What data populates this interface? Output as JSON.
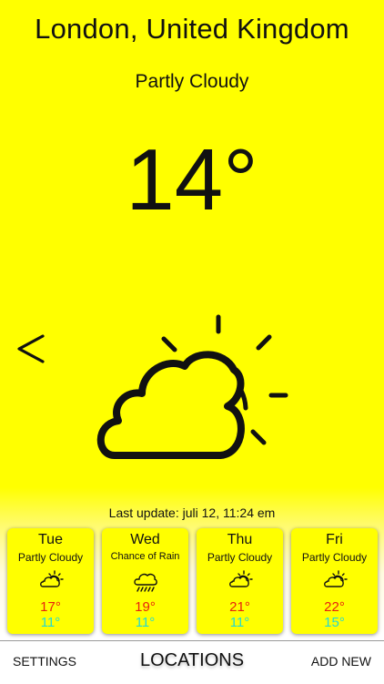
{
  "location": "London, United Kingdom",
  "current": {
    "condition": "Partly Cloudy",
    "temperature": "14°",
    "icon": "partly-cloudy-icon"
  },
  "nav": {
    "back_label": "<"
  },
  "last_update": "Last update: juli 12, 11:24 em",
  "forecast": [
    {
      "day": "Tue",
      "condition": "Partly Cloudy",
      "icon": "partly-cloudy-icon",
      "high": "17°",
      "low": "11°"
    },
    {
      "day": "Wed",
      "condition": "Chance of Rain",
      "icon": "rain-cloud-icon",
      "high": "19°",
      "low": "11°"
    },
    {
      "day": "Thu",
      "condition": "Partly Cloudy",
      "icon": "partly-cloudy-icon",
      "high": "21°",
      "low": "11°"
    },
    {
      "day": "Fri",
      "condition": "Partly Cloudy",
      "icon": "partly-cloudy-icon",
      "high": "22°",
      "low": "15°"
    }
  ],
  "bottom_bar": {
    "settings": "SETTINGS",
    "locations": "LOCATIONS",
    "add_new": "ADD NEW"
  },
  "colors": {
    "background": "#ffff00",
    "high_temp": "#e8220e",
    "low_temp": "#24d9d2"
  }
}
